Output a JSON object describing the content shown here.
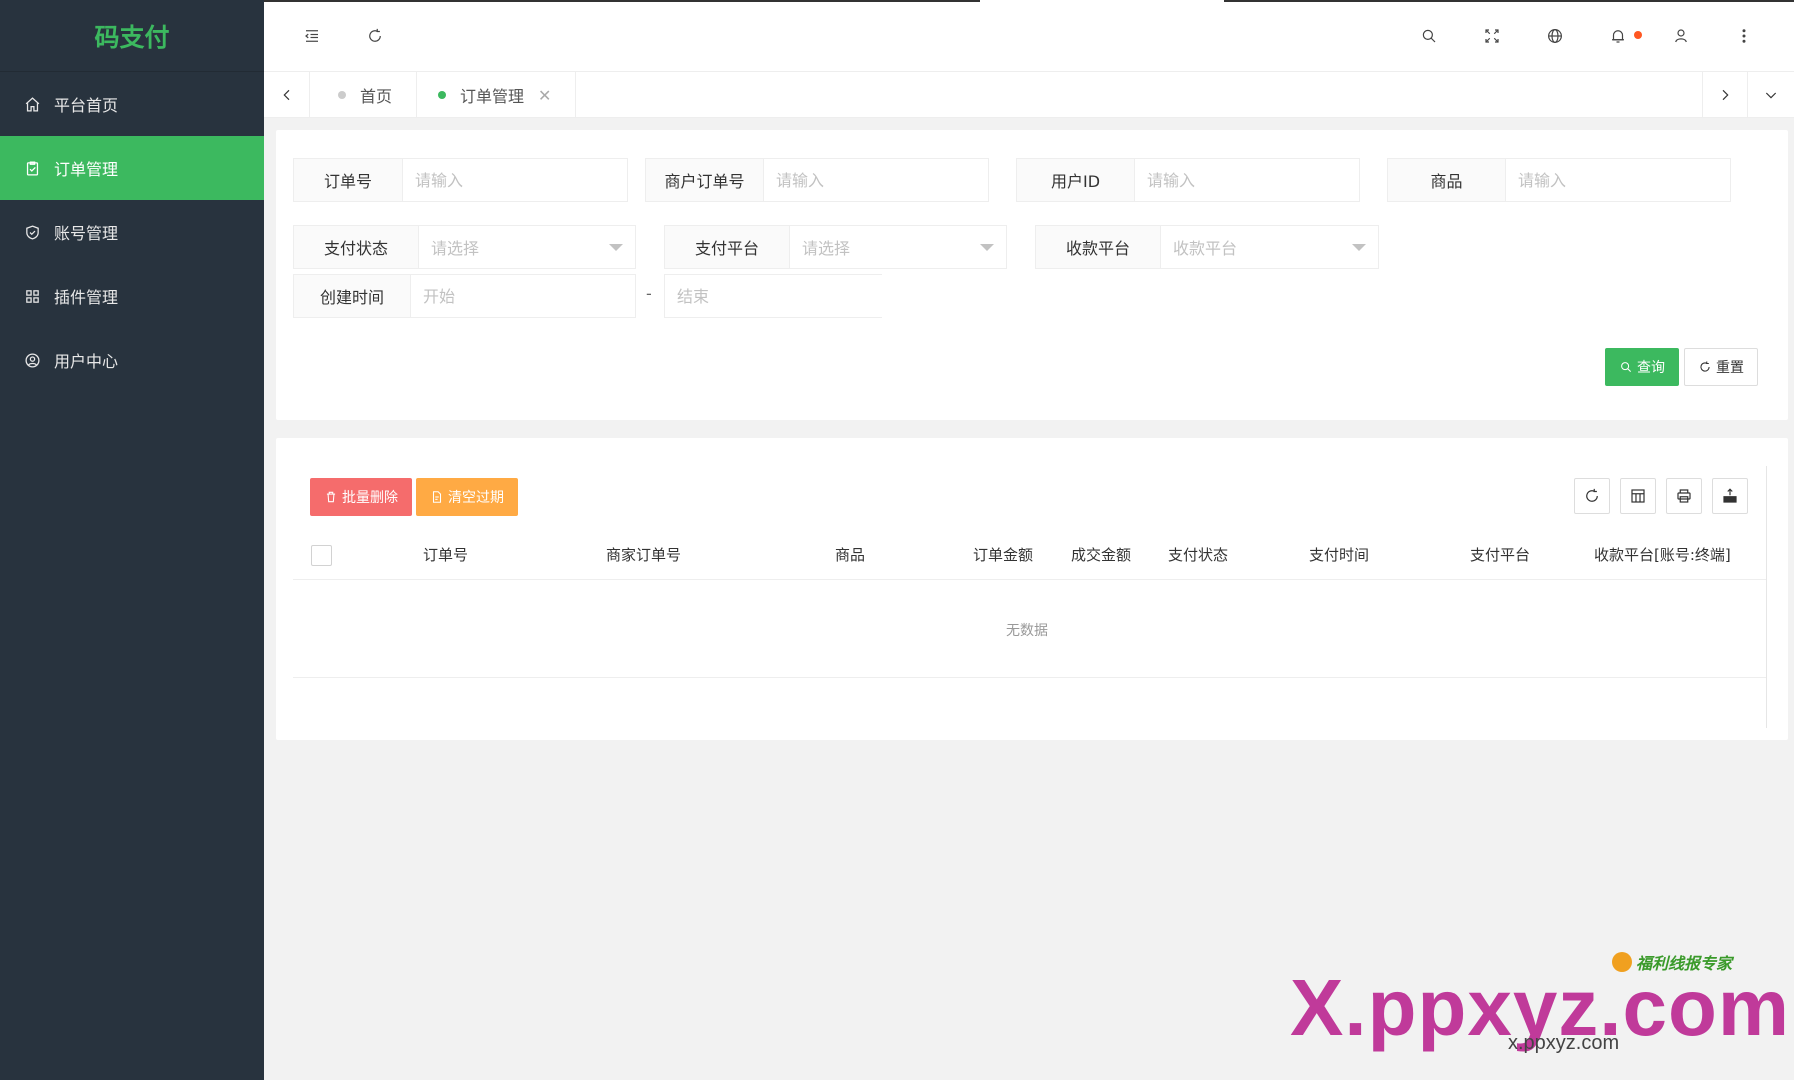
{
  "app": {
    "title": "码支付"
  },
  "sidebar": {
    "items": [
      {
        "label": "平台首页",
        "icon": "home-icon"
      },
      {
        "label": "订单管理",
        "icon": "clipboard-check-icon",
        "active": true
      },
      {
        "label": "账号管理",
        "icon": "shield-check-icon"
      },
      {
        "label": "插件管理",
        "icon": "grid-icon"
      },
      {
        "label": "用户中心",
        "icon": "user-circle-icon"
      }
    ]
  },
  "header": {
    "icons": [
      "menu-fold-icon",
      "refresh-icon",
      "search-icon",
      "fullscreen-icon",
      "globe-icon",
      "bell-icon",
      "user-icon",
      "more-vertical-icon"
    ]
  },
  "tabs": [
    {
      "label": "首页",
      "active": false
    },
    {
      "label": "订单管理",
      "active": true,
      "closable": true
    }
  ],
  "filters": {
    "order_no": {
      "label": "订单号",
      "placeholder": "请输入"
    },
    "merchant_order_no": {
      "label": "商户订单号",
      "placeholder": "请输入"
    },
    "user_id": {
      "label": "用户ID",
      "placeholder": "请输入"
    },
    "product": {
      "label": "商品",
      "placeholder": "请输入"
    },
    "pay_status": {
      "label": "支付状态",
      "placeholder": "请选择"
    },
    "pay_platform": {
      "label": "支付平台",
      "placeholder": "请选择"
    },
    "receive_platform": {
      "label": "收款平台",
      "placeholder": "收款平台"
    },
    "created_time": {
      "label": "创建时间",
      "start_placeholder": "开始",
      "separator": "-",
      "end_placeholder": "结束"
    },
    "query_button": "查询",
    "reset_button": "重置"
  },
  "table": {
    "batch_delete_button": "批量删除",
    "clear_expired_button": "清空过期",
    "columns": [
      "订单号",
      "商家订单号",
      "商品",
      "订单金额",
      "成交金额",
      "支付状态",
      "支付时间",
      "支付平台",
      "收款平台[账号:终端]"
    ],
    "empty_text": "无数据"
  },
  "watermark": {
    "small": "福利线报专家",
    "big": "X.ppxyz.com",
    "url": "x.ppxyz.com"
  },
  "colors": {
    "accent": "#3cb95f",
    "sidebar": "#28333e",
    "danger": "#f56c6c",
    "warning": "#ffaa44"
  }
}
